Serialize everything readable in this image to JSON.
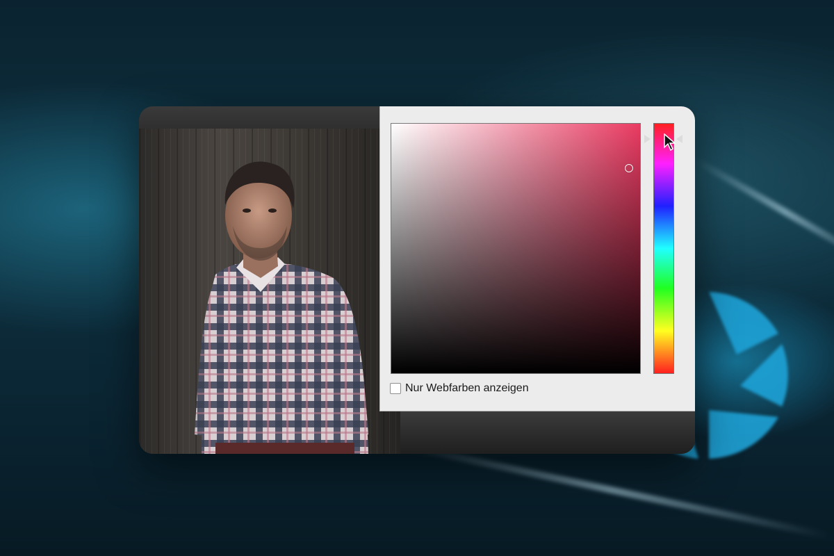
{
  "color_picker": {
    "web_colors_checkbox": {
      "label": "Nur Webfarben anzeigen",
      "checked": false
    },
    "selected_hue_color": "#ea3b62",
    "icons": {
      "saturation_marker": "circle-marker-icon",
      "hue_indicators": "triangle-arrow-icon"
    }
  },
  "photo": {
    "subject": "man-in-plaid-shirt-photo"
  },
  "cursor": {
    "icon": "arrow-pointer-icon"
  }
}
